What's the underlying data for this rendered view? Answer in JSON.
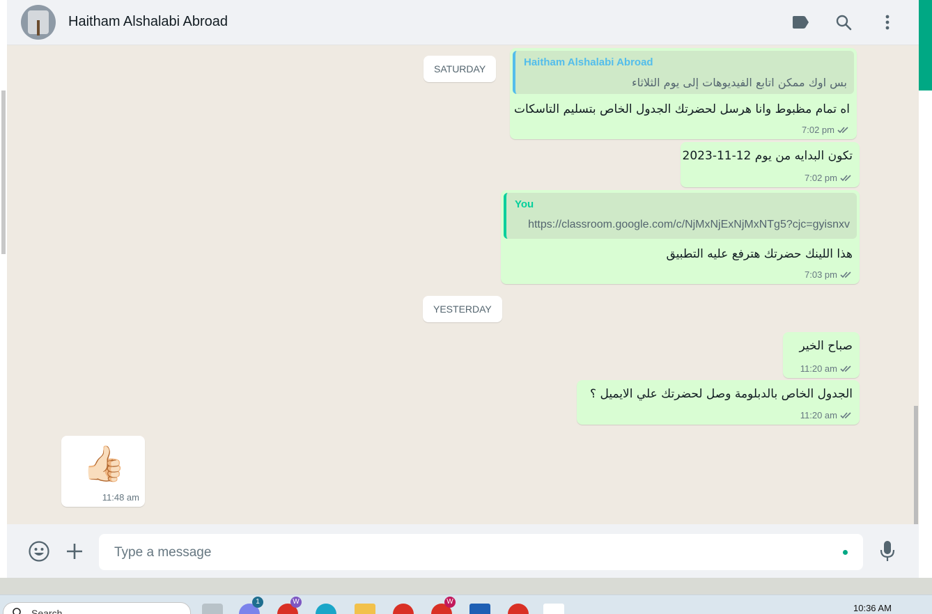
{
  "header": {
    "contact_name": "Haitham Alshalabi Abroad",
    "icons": [
      "label-icon",
      "search-icon",
      "menu-icon"
    ]
  },
  "chat": {
    "day_separators": {
      "saturday": "SATURDAY",
      "yesterday": "YESTERDAY"
    },
    "messages": [
      {
        "direction": "out",
        "quote_author": "Haitham Alshalabi Abroad",
        "quote_text": "بس اوك ممكن اتابع الفيديوهات إلى يوم الثلاثاء",
        "text": "اه تمام مظبوط وانا هرسل لحضرتك الجدول الخاص بتسليم التاسكات",
        "time": "7:02 pm",
        "status": "read"
      },
      {
        "direction": "out",
        "text": "تكون البدايه من يوم 12-11-2023",
        "time": "7:02 pm",
        "status": "read"
      },
      {
        "direction": "out",
        "quote_author": "You",
        "quote_text": "https://classroom.google.com/c/NjMxNjExNjMxNTg5?cjc=gyisnxv",
        "text": "هذا اللينك حضرتك هترفع عليه التطبيق",
        "time": "7:03 pm",
        "status": "read"
      },
      {
        "direction": "out",
        "text": "صباح الخير",
        "time": "11:20 am",
        "status": "read"
      },
      {
        "direction": "out",
        "text": "الجدول الخاص بالدبلومة وصل لحضرتك علي الايميل ؟",
        "time": "11:20 am",
        "status": "read"
      },
      {
        "direction": "in",
        "text": "👍🏻",
        "time": "11:48 am"
      }
    ]
  },
  "composer": {
    "placeholder": "Type a message",
    "value": "",
    "icons": [
      "emoji-icon",
      "attach-plus-icon",
      "microphone-icon"
    ]
  },
  "taskbar": {
    "search_label": "Search",
    "clock": "10:36 AM",
    "badge_teams": "1",
    "badge_w1": "W",
    "badge_w2": "W"
  },
  "colors": {
    "outgoing_bubble": "#d9fdd3",
    "incoming_bubble": "#ffffff",
    "chat_background": "#efeae2",
    "accent": "#00a884",
    "read_ticks": "#667781",
    "quote_author_other": "#53bdeb",
    "quote_author_you": "#06cf9c"
  }
}
